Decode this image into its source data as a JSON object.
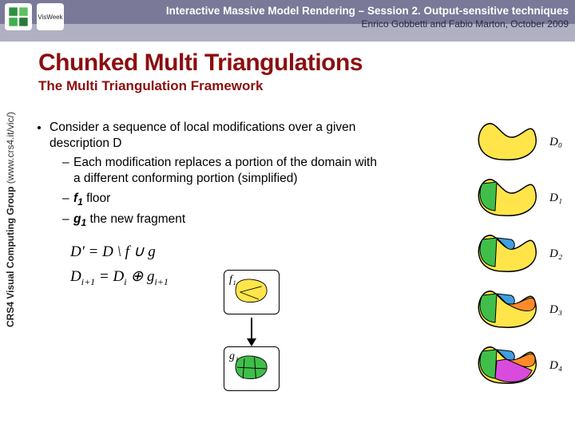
{
  "header": {
    "session_line": "Interactive Massive Model Rendering – Session 2. Output-sensitive techniques",
    "authors_line": "Enrico Gobbetti and Fabio Marton, October 2009",
    "logo_visweek_text": "VisWeek"
  },
  "title": "Chunked Multi Triangulations",
  "subtitle": "The Multi Triangulation Framework",
  "sidebar": {
    "group": "CRS4 Visual Computing Group",
    "url": "(www.crs4.it/vic/)"
  },
  "bullets": {
    "b1": "Consider a sequence of local modifications over a given description D",
    "b1a": "Each modification replaces a portion of the domain with a different conforming portion (simplified)",
    "b1b_prefix": "f",
    "b1b_sub": "1",
    "b1b_suffix": " floor",
    "b1c_prefix": "g",
    "b1c_sub": "1",
    "b1c_suffix": " the new fragment"
  },
  "math": {
    "line1": "D' = D \\ f ∪ g",
    "line2_a": "D",
    "line2_a_sub": "i+1",
    "line2_eq": " = D",
    "line2_b_sub": "i",
    "line2_op": " ⊕ g",
    "line2_c_sub": "i+1"
  },
  "diagram_labels": {
    "f1": "f₁",
    "g1": "g₁"
  },
  "right_labels": {
    "d0": "D₀",
    "d1": "D₁",
    "d2": "D₂",
    "d3": "D₃",
    "d4": "D₄"
  },
  "colors": {
    "title_red": "#8b0f10",
    "header_purple": "#7a7998"
  }
}
